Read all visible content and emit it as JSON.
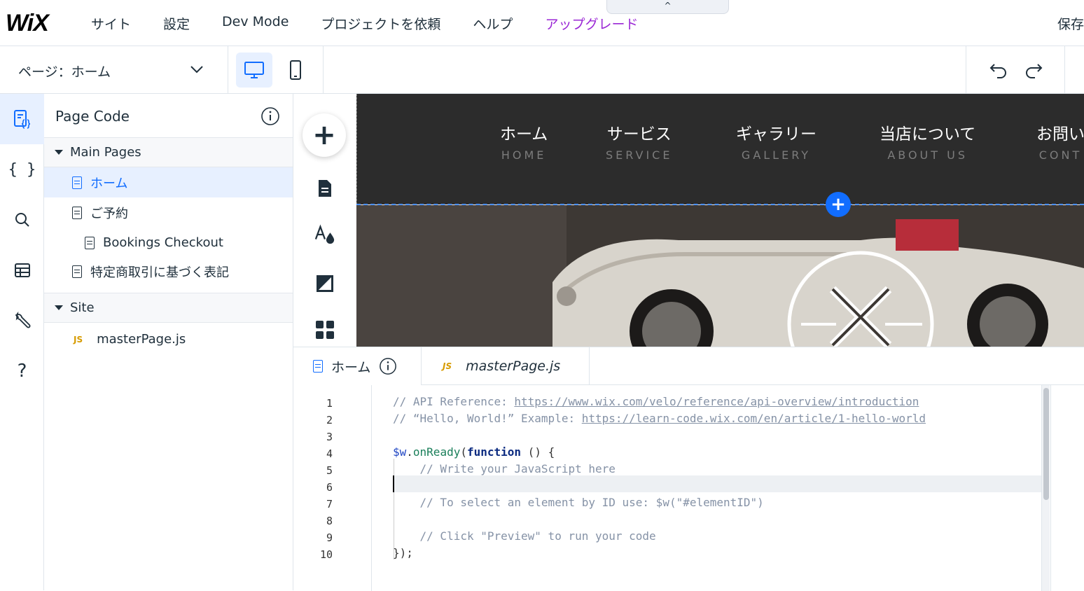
{
  "topbar": {
    "logo": "WiX",
    "menu": [
      "サイト",
      "設定",
      "Dev Mode",
      "プロジェクトを依頼",
      "ヘルプ",
      "アップグレード"
    ],
    "collapse_icon": "^",
    "save": "保存"
  },
  "pagebar": {
    "page_label": "ページ：ホーム"
  },
  "panel": {
    "title": "Page Code",
    "main_pages_label": "Main Pages",
    "pages": [
      "ホーム",
      "ご予約",
      "Bookings Checkout",
      "特定商取引に基づく表記"
    ],
    "site_label": "Site",
    "site_files": [
      "masterPage.js"
    ]
  },
  "site": {
    "nav": [
      {
        "jp": "ホーム",
        "en": "HOME"
      },
      {
        "jp": "サービス",
        "en": "SERVICE"
      },
      {
        "jp": "ギャラリー",
        "en": "GALLERY"
      },
      {
        "jp": "当店について",
        "en": "ABOUT US"
      },
      {
        "jp": "お問い",
        "en": "CONT"
      }
    ]
  },
  "code": {
    "tabs": [
      {
        "label": "ホーム",
        "icon": "page-icon"
      },
      {
        "label": "masterPage.js",
        "icon": "JS"
      }
    ],
    "js_badge": "JS",
    "line_numbers": [
      "1",
      "2",
      "3",
      "4",
      "5",
      "6",
      "7",
      "8",
      "9",
      "10"
    ],
    "lines": {
      "l1_prefix": "// API Reference: ",
      "l1_link": "https://www.wix.com/velo/reference/api-overview/introduction",
      "l2_prefix": "// “Hello, World!” Example: ",
      "l2_link": "https://learn-code.wix.com/en/article/1-hello-world",
      "l4_var": "$w",
      "l4_dot": ".",
      "l4_fn": "onReady",
      "l4_paren": "(",
      "l4_kw": "function",
      "l4_rest": " () {",
      "l5": "    // Write your JavaScript here",
      "l7": "    // To select an element by ID use: $w(\"#elementID\")",
      "l9": "    // Click \"Preview\" to run your code",
      "l10": "});"
    }
  }
}
